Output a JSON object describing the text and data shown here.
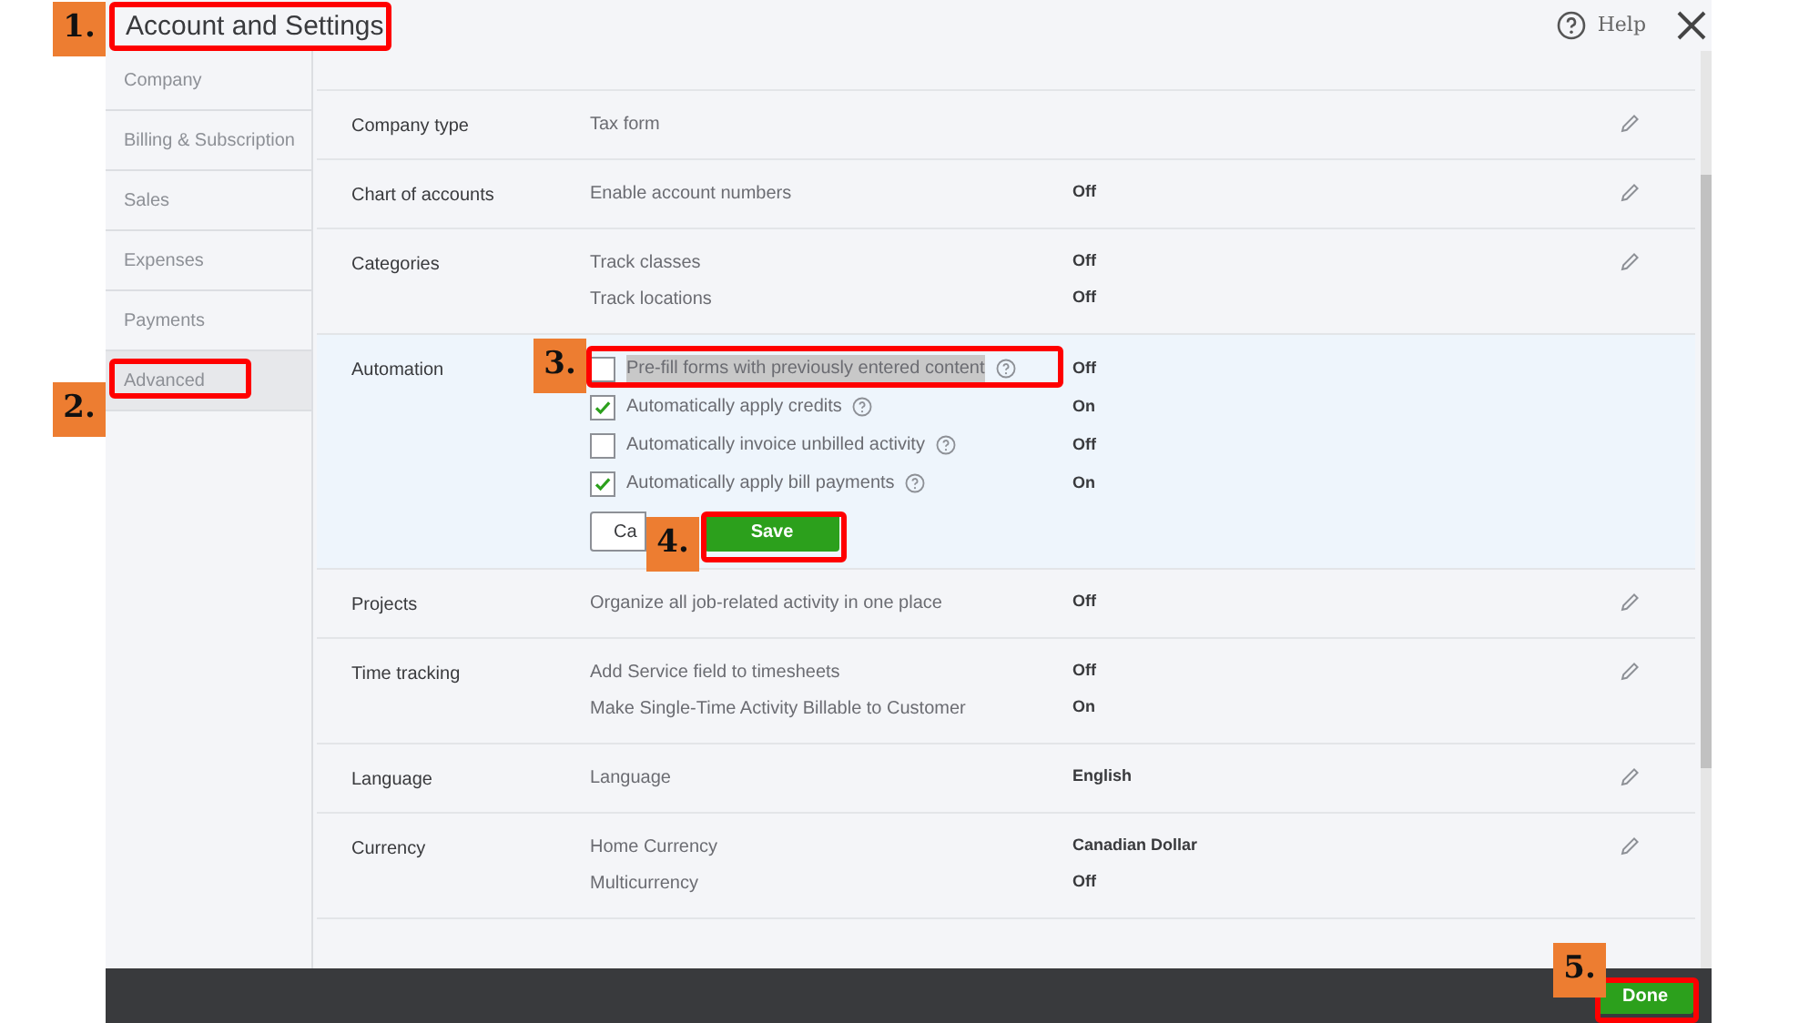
{
  "window": {
    "title": "Account and Settings",
    "help": "Help"
  },
  "sidebar": {
    "items": [
      {
        "label": "Company",
        "selected": false
      },
      {
        "label": "Billing & Subscription",
        "selected": false
      },
      {
        "label": "Sales",
        "selected": false
      },
      {
        "label": "Expenses",
        "selected": false
      },
      {
        "label": "Payments",
        "selected": false
      },
      {
        "label": "Advanced",
        "selected": true
      }
    ]
  },
  "sections": [
    {
      "kind": "view",
      "label": "Company type",
      "settings": [
        {
          "name": "Tax form"
        }
      ]
    },
    {
      "kind": "view",
      "label": "Chart of accounts",
      "settings": [
        {
          "name": "Enable account numbers",
          "value": "Off"
        }
      ]
    },
    {
      "kind": "view",
      "label": "Categories",
      "settings": [
        {
          "name": "Track classes",
          "value": "Off"
        },
        {
          "name": "Track locations",
          "value": "Off"
        }
      ]
    },
    {
      "kind": "edit",
      "label": "Automation",
      "settings": [
        {
          "name": "Pre-fill forms with previously entered content",
          "value": "Off",
          "checked": false,
          "text_selected": true
        },
        {
          "name": "Automatically apply credits",
          "value": "On",
          "checked": true,
          "text_selected": false
        },
        {
          "name": "Automatically invoice unbilled activity",
          "value": "Off",
          "checked": false,
          "text_selected": false
        },
        {
          "name": "Automatically apply bill payments",
          "value": "On",
          "checked": true,
          "text_selected": false
        }
      ],
      "cancel": "Ca",
      "save": "Save"
    },
    {
      "kind": "view",
      "label": "Projects",
      "settings": [
        {
          "name": "Organize all job-related activity in one place",
          "value": "Off"
        }
      ]
    },
    {
      "kind": "view",
      "label": "Time tracking",
      "settings": [
        {
          "name": "Add Service field to timesheets",
          "value": "Off"
        },
        {
          "name": "Make Single-Time Activity Billable to Customer",
          "value": "On"
        }
      ]
    },
    {
      "kind": "view",
      "label": "Language",
      "settings": [
        {
          "name": "Language",
          "value": "English"
        }
      ]
    },
    {
      "kind": "view",
      "label": "Currency",
      "settings": [
        {
          "name": "Home Currency",
          "value": "Canadian Dollar"
        },
        {
          "name": "Multicurrency",
          "value": "Off"
        }
      ]
    }
  ],
  "footer": {
    "done": "Done"
  },
  "annotations": [
    {
      "number": "1."
    },
    {
      "number": "2."
    },
    {
      "number": "3."
    },
    {
      "number": "4."
    },
    {
      "number": "5."
    }
  ]
}
